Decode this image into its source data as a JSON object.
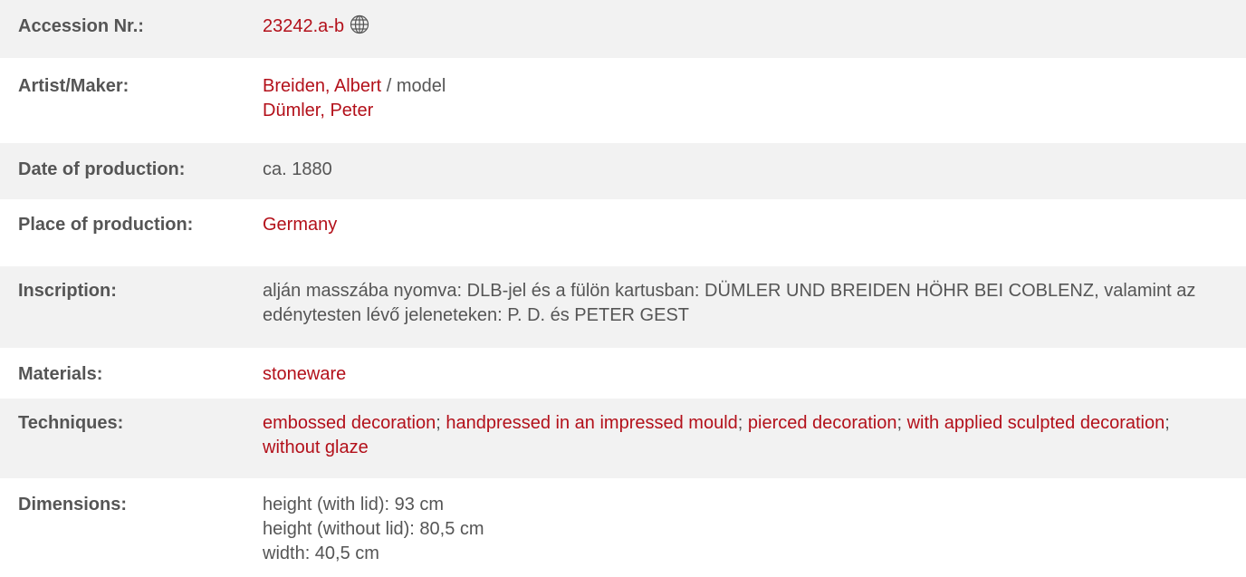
{
  "rows": {
    "accession": {
      "label": "Accession Nr.:",
      "value": "23242.a-b",
      "icon": "globe-icon"
    },
    "artist": {
      "label": "Artist/Maker:",
      "maker1": "Breiden, Albert",
      "role1": " / model",
      "maker2": "Dümler, Peter"
    },
    "date": {
      "label": "Date of production:",
      "value": "ca. 1880"
    },
    "place": {
      "label": "Place of production:",
      "value": "Germany"
    },
    "inscription": {
      "label": "Inscription:",
      "value": "alján masszába nyomva: DLB-jel és a fülön kartusban: DÜMLER UND BREIDEN HÖHR BEI COBLENZ, valamint az edénytesten lévő jeleneteken: P. D. és PETER GEST"
    },
    "materials": {
      "label": "Materials:",
      "value": "stoneware"
    },
    "techniques": {
      "label": "Techniques:",
      "items": [
        "embossed decoration",
        "handpressed in an impressed mould",
        "pierced decoration",
        "with applied sculpted decoration",
        "without glaze"
      ],
      "sep": "; "
    },
    "dimensions": {
      "label": "Dimensions:",
      "lines": [
        "height (with lid): 93 cm",
        "height (without lid): 80,5 cm",
        "width: 40,5 cm"
      ]
    }
  },
  "colors": {
    "link": "#b3101a",
    "text": "#555555",
    "row_shade": "#f2f2f2"
  }
}
